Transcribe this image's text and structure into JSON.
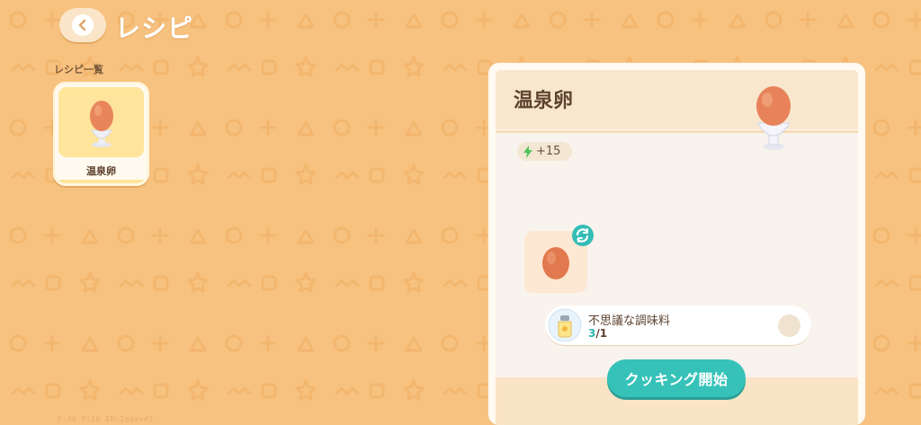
{
  "header": {
    "title": "レシピ"
  },
  "recipe_list": {
    "section_label": "レシピ一覧",
    "items": [
      {
        "label": "温泉卵"
      }
    ]
  },
  "detail": {
    "title": "温泉卵",
    "energy": "+15",
    "ingredient": {
      "name": "不思議な調味料",
      "have": "3",
      "need": "/1"
    },
    "cook_button": "クッキング開始"
  },
  "debug": "F:30 P:16 ID:2qqevd3",
  "colors": {
    "background": "#f7c27f",
    "accent_teal": "#36c2b9",
    "panel": "#fffaf2"
  },
  "icons": [
    "back-arrow-icon",
    "egg-cup-icon",
    "lightning-icon",
    "egg-icon",
    "swap-icon",
    "seasoning-jar-icon"
  ]
}
